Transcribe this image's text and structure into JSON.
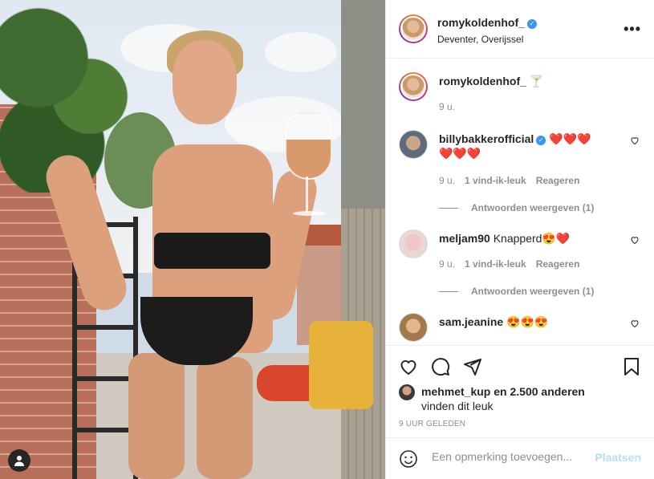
{
  "post": {
    "author": {
      "username": "romykoldenhof_",
      "location": "Deventer, Overijssel",
      "verified": true
    },
    "caption": {
      "username": "romykoldenhof_",
      "text": "🍸",
      "time": "9 u."
    },
    "comments": [
      {
        "username": "billybakkerofficial",
        "verified": true,
        "text": "❤️❤️❤️❤️❤️❤️",
        "time": "9 u.",
        "likes": "1 vind-ik-leuk",
        "reply": "Reageren",
        "view_replies": "Antwoorden weergeven (1)"
      },
      {
        "username": "meljam90",
        "verified": false,
        "text": "Knapperd😍❤️",
        "time": "9 u.",
        "likes": "1 vind-ik-leuk",
        "reply": "Reageren",
        "view_replies": "Antwoorden weergeven (1)"
      },
      {
        "username": "sam.jeanine",
        "verified": false,
        "text": "😍😍😍"
      }
    ],
    "liked_by": {
      "username": "mehmet_kup",
      "text": "en 2.500 anderen",
      "suffix": "vinden dit leuk"
    },
    "timestamp": "9 UUR GELEDEN",
    "add_comment": {
      "placeholder": "Een opmerking toevoegen...",
      "post_label": "Plaatsen"
    }
  },
  "icons": [
    "user-icon",
    "more-icon",
    "heart-icon",
    "comment-icon",
    "share-icon",
    "bookmark-icon",
    "emoji-icon",
    "verified-icon"
  ],
  "colors": {
    "link_blue_disabled": "#b2dffc",
    "verified": "#3897f0",
    "muted": "#8e8e8e"
  }
}
